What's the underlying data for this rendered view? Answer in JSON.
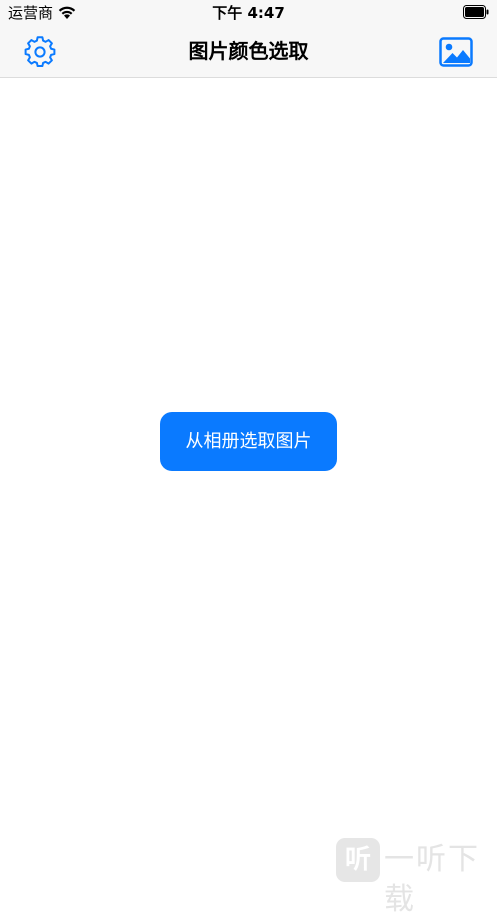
{
  "status_bar": {
    "carrier": "运营商",
    "time": "下午 4:47",
    "wifi_icon": "wifi-icon",
    "battery_icon": "battery-icon"
  },
  "nav": {
    "title": "图片颜色选取",
    "left_icon": "gear-icon",
    "right_icon": "photo-icon",
    "accent_color": "#0a7aff"
  },
  "main": {
    "pick_button_label": "从相册选取图片",
    "button_color": "#0a7aff"
  },
  "watermark": {
    "logo_text": "听",
    "text": "一听下载"
  }
}
